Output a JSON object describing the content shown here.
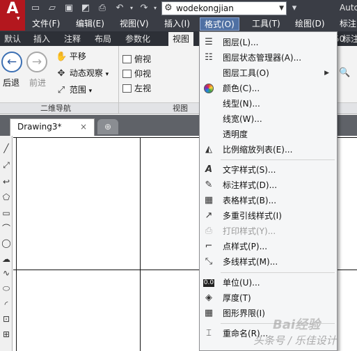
{
  "app": {
    "logo_letter": "A",
    "title_partial": "Autc"
  },
  "quick_access": {
    "icons": [
      "new-file-icon",
      "open-folder-icon",
      "save-icon",
      "save-as-icon",
      "print-icon",
      "undo-icon",
      "redo-icon"
    ],
    "workspace": "wodekongjian"
  },
  "menubar": [
    "文件(F)",
    "编辑(E)",
    "视图(V)",
    "插入(I)",
    "格式(O)",
    "工具(T)",
    "绘图(D)",
    "标注"
  ],
  "ribbon_tabs": [
    "默认",
    "插入",
    "注释",
    "布局",
    "参数化",
    "视图",
    "50",
    "标注"
  ],
  "ribbon": {
    "nav": {
      "back": "后退",
      "forward": "前进",
      "pan": "平移",
      "orbit": "动态观察",
      "extents": "范围",
      "title": "二维导航"
    },
    "views": {
      "items": [
        "俯视",
        "仰视",
        "左视"
      ],
      "title": "视图"
    }
  },
  "file_tab": {
    "name": "Drawing3*",
    "close": "×"
  },
  "format_menu": {
    "items": [
      {
        "label": "图层(L)...",
        "icon": "layer-icon",
        "enabled": true
      },
      {
        "label": "图层状态管理器(A)...",
        "icon": "layer-state-icon",
        "enabled": true
      },
      {
        "label": "图层工具(O)",
        "icon": "",
        "enabled": true,
        "submenu": true
      },
      {
        "label": "颜色(C)...",
        "icon": "color-wheel-icon",
        "enabled": true
      },
      {
        "label": "线型(N)...",
        "icon": "",
        "enabled": true
      },
      {
        "label": "线宽(W)...",
        "icon": "",
        "enabled": true
      },
      {
        "label": "透明度",
        "icon": "",
        "enabled": true
      },
      {
        "label": "比例缩放列表(E)...",
        "icon": "scale-list-icon",
        "enabled": true
      },
      {
        "label": "文字样式(S)...",
        "icon": "text-style-icon",
        "enabled": true
      },
      {
        "label": "标注样式(D)...",
        "icon": "dimension-style-icon",
        "enabled": true
      },
      {
        "label": "表格样式(B)...",
        "icon": "table-style-icon",
        "enabled": true
      },
      {
        "label": "多重引线样式(I)",
        "icon": "multileader-style-icon",
        "enabled": true
      },
      {
        "label": "打印样式(Y)...",
        "icon": "plot-style-icon",
        "enabled": false
      },
      {
        "label": "点样式(P)...",
        "icon": "point-style-icon",
        "enabled": true
      },
      {
        "label": "多线样式(M)...",
        "icon": "multiline-style-icon",
        "enabled": true
      },
      {
        "label": "单位(U)...",
        "icon": "units-icon",
        "enabled": true
      },
      {
        "label": "厚度(T)",
        "icon": "thickness-icon",
        "enabled": true
      },
      {
        "label": "图形界限(I)",
        "icon": "drawing-limits-icon",
        "enabled": true
      },
      {
        "label": "重命名(R)...",
        "icon": "rename-icon",
        "enabled": true
      }
    ]
  },
  "watermark": {
    "line1": "Bai经验",
    "line2": "头条号 / 乐佳设计"
  },
  "colors": {
    "titlebar": "#3a3d45",
    "menu_highlight": "#4f70a3",
    "autocad_red": "#b3171e",
    "ribbon_bg": "#f3f3f3"
  }
}
